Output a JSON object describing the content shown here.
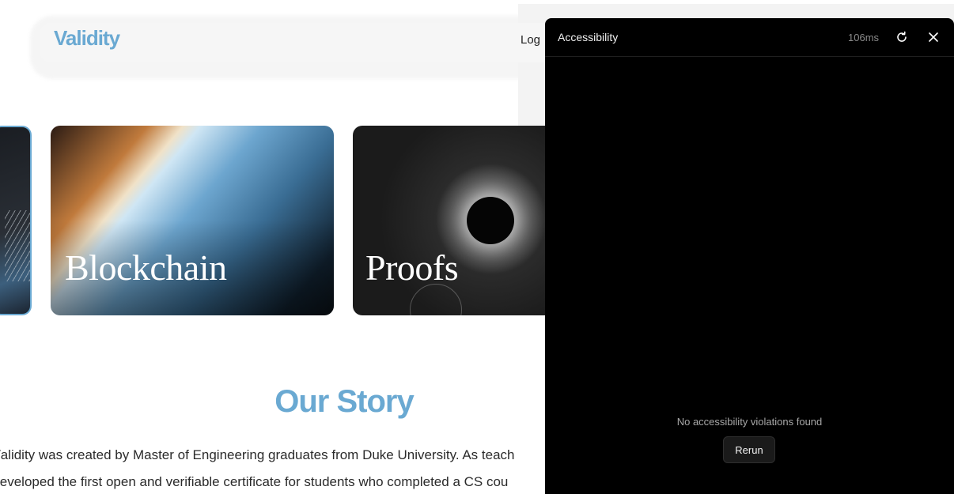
{
  "site": {
    "brand": "Validity",
    "nav_login": "Log",
    "cards": [
      {
        "label": "Blockchain"
      },
      {
        "label": "Proofs"
      }
    ],
    "story": {
      "title": "Our Story",
      "line1": "/alidity was created by Master of Engineering graduates from Duke University. As teach",
      "line2": "leveloped the first open and verifiable certificate for students who completed a CS cou"
    },
    "colors": {
      "accent": "#6aa9d2"
    }
  },
  "panel": {
    "title": "Accessibility",
    "timing": "106ms",
    "refresh_icon": "refresh-icon",
    "close_icon": "close-icon",
    "empty_message": "No accessibility violations found",
    "rerun_label": "Rerun"
  }
}
